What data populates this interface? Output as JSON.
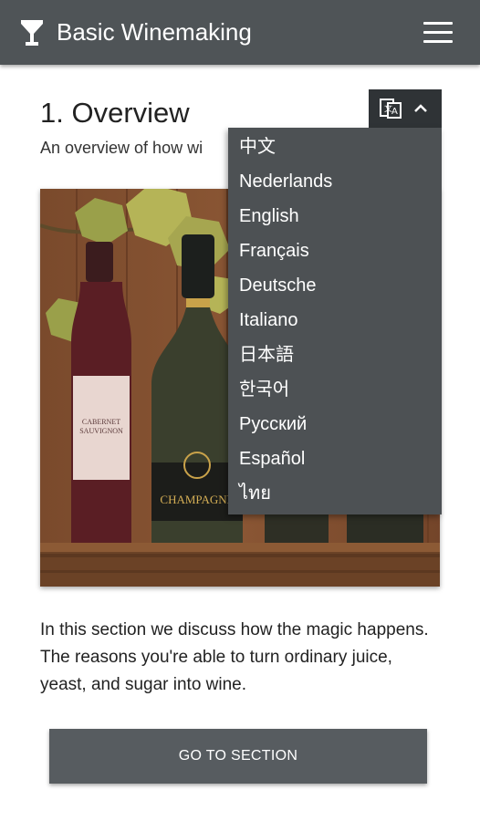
{
  "app": {
    "title": "Basic Winemaking"
  },
  "section": {
    "title": "1. Overview",
    "subtitle": "An overview of how wi",
    "body": "In this section we discuss how the magic happens. The reasons you're able to turn ordinary juice, yeast, and sugar into wine.",
    "button_label": "GO TO SECTION"
  },
  "illustration": {
    "bottle1_label": "CABERNET SAUVIGNON",
    "bottle2_label": "CHAMPAGNE"
  },
  "language_menu": {
    "items": [
      "中文",
      "Nederlands",
      "English",
      "Français",
      "Deutsche",
      "Italiano",
      "日本語",
      "한국어",
      "Русский",
      "Español",
      "ไทย"
    ]
  },
  "colors": {
    "appbar": "#4f5457",
    "menu_bg": "#4d5154",
    "toggle_bg": "#2f3336",
    "button_bg": "#575c60"
  },
  "icons": {
    "logo": "wine-glass-icon",
    "menu": "hamburger-menu-icon",
    "translate": "translate-icon",
    "toggle": "chevron-up-icon"
  }
}
